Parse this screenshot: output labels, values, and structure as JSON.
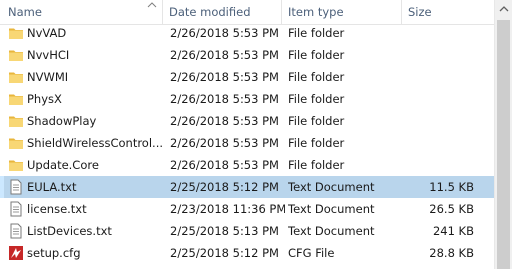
{
  "columns": {
    "name": "Name",
    "date": "Date modified",
    "type": "Item type",
    "size": "Size",
    "sort_icon": "sort-up-arrow"
  },
  "rows": [
    {
      "name": "NvVAD",
      "date": "2/26/2018 5:53 PM",
      "type": "File folder",
      "size": "",
      "icon": "folder-icon",
      "selected": false
    },
    {
      "name": "NvvHCI",
      "date": "2/26/2018 5:53 PM",
      "type": "File folder",
      "size": "",
      "icon": "folder-icon",
      "selected": false
    },
    {
      "name": "NVWMI",
      "date": "2/26/2018 5:53 PM",
      "type": "File folder",
      "size": "",
      "icon": "folder-icon",
      "selected": false
    },
    {
      "name": "PhysX",
      "date": "2/26/2018 5:53 PM",
      "type": "File folder",
      "size": "",
      "icon": "folder-icon",
      "selected": false
    },
    {
      "name": "ShadowPlay",
      "date": "2/26/2018 5:53 PM",
      "type": "File folder",
      "size": "",
      "icon": "folder-icon",
      "selected": false
    },
    {
      "name": "ShieldWirelessControl...",
      "date": "2/26/2018 5:53 PM",
      "type": "File folder",
      "size": "",
      "icon": "folder-icon",
      "selected": false
    },
    {
      "name": "Update.Core",
      "date": "2/26/2018 5:53 PM",
      "type": "File folder",
      "size": "",
      "icon": "folder-icon",
      "selected": false
    },
    {
      "name": "EULA.txt",
      "date": "2/25/2018 5:12 PM",
      "type": "Text Document",
      "size": "11.5 KB",
      "icon": "text-file-icon",
      "selected": true
    },
    {
      "name": "license.txt",
      "date": "2/23/2018 11:36 PM",
      "type": "Text Document",
      "size": "26.5 KB",
      "icon": "text-file-icon",
      "selected": false
    },
    {
      "name": "ListDevices.txt",
      "date": "2/25/2018 5:13 PM",
      "type": "Text Document",
      "size": "241 KB",
      "icon": "text-file-icon",
      "selected": false
    },
    {
      "name": "setup.cfg",
      "date": "2/25/2018 5:12 PM",
      "type": "CFG File",
      "size": "28.8 KB",
      "icon": "cfg-file-icon",
      "selected": false
    }
  ],
  "colors": {
    "header_text": "#4c607a",
    "selected_row": "#b9d5ec",
    "folder": "#f8d775",
    "cfg_icon": "#c62828"
  }
}
